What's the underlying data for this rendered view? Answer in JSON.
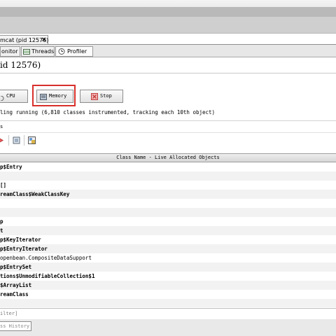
{
  "document_tab": {
    "title": "mcat (pid 12576)",
    "close": "×"
  },
  "subtabs": [
    {
      "label": "onitor",
      "icon": "monitor-icon"
    },
    {
      "label": "Threads",
      "icon": "threads-icon"
    },
    {
      "label": "Profiler",
      "icon": "profiler-clock-icon"
    }
  ],
  "view_title": "id 12576)",
  "buttons": {
    "cpu": "CPU",
    "memory": "Memory",
    "stop": "Stop"
  },
  "status_text": "ling running (6,810 classes instrumented, tracking each 10th object)",
  "results_label": "s",
  "table": {
    "header": "Class Name - Live Allocated Objects",
    "rows": [
      {
        "name": "p$Entry",
        "bold": true
      },
      {
        "name": "",
        "bold": true
      },
      {
        "name": "[]",
        "bold": true
      },
      {
        "name": "reamClass$WeakClassKey",
        "bold": true
      },
      {
        "name": "",
        "bold": true
      },
      {
        "name": "",
        "bold": true
      },
      {
        "name": "p",
        "bold": true
      },
      {
        "name": "t",
        "bold": true
      },
      {
        "name": "p$KeyIterator",
        "bold": true
      },
      {
        "name": "p$EntryIterator",
        "bold": true
      },
      {
        "name": "openbean.CompositeDataSupport",
        "bold": false
      },
      {
        "name": "p$EntrySet",
        "bold": true
      },
      {
        "name": "tions$UnmodifiableCollection$1",
        "bold": true
      },
      {
        "name": "$ArrayList",
        "bold": true
      },
      {
        "name": "reamClass",
        "bold": true
      }
    ]
  },
  "filter_placeholder": "ilter]",
  "history_tab": "ss History"
}
